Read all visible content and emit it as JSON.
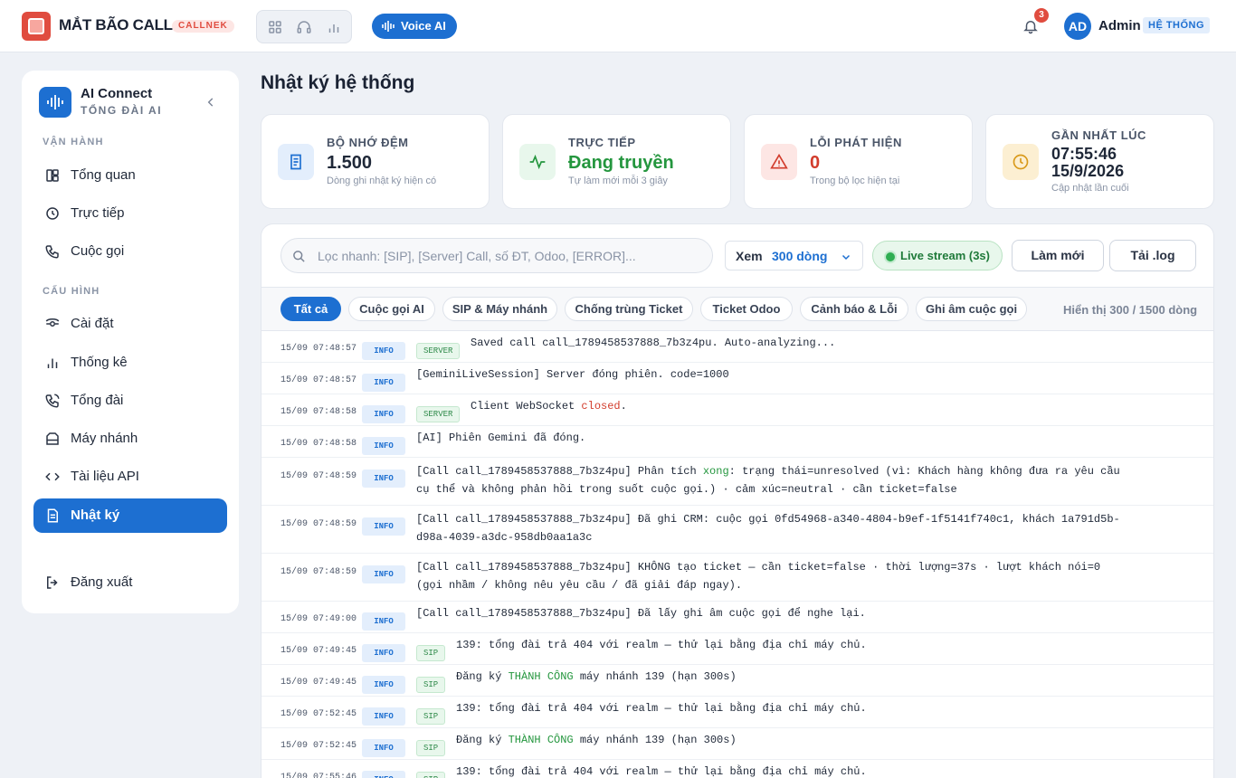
{
  "header": {
    "brand": "MẮT BÃO CALL",
    "brand_tag": "CALLNEK",
    "voice_ai": "Voice AI",
    "notif_count": "3",
    "avatar": "AD",
    "user": "Admin",
    "role": "HỆ THỐNG"
  },
  "sidebar": {
    "title": "AI Connect",
    "subtitle": "TỔNG ĐÀI AI",
    "section1": "VẬN HÀNH",
    "section2": "CẤU HÌNH",
    "items": [
      {
        "label": "Tổng quan"
      },
      {
        "label": "Trực tiếp"
      },
      {
        "label": "Cuộc gọi"
      },
      {
        "label": "Cài đặt"
      },
      {
        "label": "Thống kê"
      },
      {
        "label": "Tổng đài"
      },
      {
        "label": "Máy nhánh"
      },
      {
        "label": "Tài liệu API"
      },
      {
        "label": "Nhật ký"
      }
    ],
    "logout": "Đăng xuất"
  },
  "page": {
    "title": "Nhật ký hệ thống"
  },
  "cards": [
    {
      "label": "BỘ NHỚ ĐỆM",
      "value": "1.500",
      "sub": "Dòng ghi nhật ký hiện có",
      "color": "#1d6fd1",
      "icon": "document-icon"
    },
    {
      "label": "TRỰC TIẾP",
      "value": "Đang truyền",
      "sub": "Tự làm mới mỗi 3 giây",
      "color": "#24963e",
      "icon": "pulse-icon"
    },
    {
      "label": "LỖI PHÁT HIỆN",
      "value": "0",
      "sub": "Trong bộ lọc hiện tại",
      "color": "#d23c2c",
      "icon": "warning-icon"
    },
    {
      "label": "GẦN NHẤT LÚC",
      "value": "07:55:46",
      "value2": "15/9/2026",
      "sub": "Cập nhật lần cuối",
      "color": "#d99a1b",
      "icon": "clock-icon"
    }
  ],
  "toolbar": {
    "search_placeholder": "Lọc nhanh: [SIP], [Server] Call, số ĐT, Odoo, [ERROR]...",
    "view_label": "Xem",
    "view_value": "300 dòng",
    "live": "Live stream (3s)",
    "refresh": "Làm mới",
    "download": "Tải .log"
  },
  "filters": {
    "chips": [
      "Tất cả",
      "Cuộc gọi AI",
      "SIP & Máy nhánh",
      "Chống trùng Ticket",
      "Ticket Odoo",
      "Cảnh báo & Lỗi",
      "Ghi âm cuộc gọi"
    ],
    "count": "Hiển thị 300 / 1500 dòng"
  },
  "logs": [
    {
      "ts": "15/09 07:48:57",
      "level": "INFO",
      "tag": "SERVER",
      "parts": [
        {
          "t": "Saved call call_1789458537888_7b3z4pu. Auto-analyzing..."
        }
      ]
    },
    {
      "ts": "15/09 07:48:57",
      "level": "INFO",
      "tag": "",
      "parts": [
        {
          "t": "[GeminiLiveSession] Server đóng phiên. code=1000"
        }
      ]
    },
    {
      "ts": "15/09 07:48:58",
      "level": "INFO",
      "tag": "SERVER",
      "parts": [
        {
          "t": "Client WebSocket "
        },
        {
          "t": "closed",
          "c": "red"
        },
        {
          "t": "."
        }
      ]
    },
    {
      "ts": "15/09 07:48:58",
      "level": "INFO",
      "tag": "",
      "parts": [
        {
          "t": "[AI] Phiên Gemini đã đóng."
        }
      ]
    },
    {
      "ts": "15/09 07:48:59",
      "level": "INFO",
      "tag": "",
      "parts": [
        {
          "t": "[Call call_1789458537888_7b3z4pu] Phân tích "
        },
        {
          "t": "xong",
          "c": "green"
        },
        {
          "t": ": trạng thái=unresolved (vì: Khách hàng không đưa ra yêu cầu cụ thể và không phản hồi trong suốt cuộc gọi.) · cảm xúc=neutral · cần ticket=false"
        }
      ]
    },
    {
      "ts": "15/09 07:48:59",
      "level": "INFO",
      "tag": "",
      "parts": [
        {
          "t": "[Call call_1789458537888_7b3z4pu] Đã ghi CRM: cuộc gọi 0fd54968-a340-4804-b9ef-1f5141f740c1, khách 1a791d5b-d98a-4039-a3dc-958db0aa1a3c"
        }
      ]
    },
    {
      "ts": "15/09 07:48:59",
      "level": "INFO",
      "tag": "",
      "parts": [
        {
          "t": "[Call call_1789458537888_7b3z4pu] KHÔNG tạo ticket — cần ticket=false · thời lượng=37s · lượt khách nói=0 (gọi nhầm / không nêu yêu cầu / đã giải đáp ngay)."
        }
      ]
    },
    {
      "ts": "15/09 07:49:00",
      "level": "INFO",
      "tag": "",
      "parts": [
        {
          "t": "[Call call_1789458537888_7b3z4pu] Đã lấy ghi âm cuộc gọi để nghe lại."
        }
      ]
    },
    {
      "ts": "15/09 07:49:45",
      "level": "INFO",
      "tag": "SIP",
      "parts": [
        {
          "t": "139: tổng đài trả 404 với realm — thử lại bằng địa chỉ máy chủ."
        }
      ]
    },
    {
      "ts": "15/09 07:49:45",
      "level": "INFO",
      "tag": "SIP",
      "parts": [
        {
          "t": "Đăng ký "
        },
        {
          "t": "THÀNH CÔNG",
          "c": "green"
        },
        {
          "t": " máy nhánh 139 (hạn 300s)"
        }
      ]
    },
    {
      "ts": "15/09 07:52:45",
      "level": "INFO",
      "tag": "SIP",
      "parts": [
        {
          "t": "139: tổng đài trả 404 với realm — thử lại bằng địa chỉ máy chủ."
        }
      ]
    },
    {
      "ts": "15/09 07:52:45",
      "level": "INFO",
      "tag": "SIP",
      "parts": [
        {
          "t": "Đăng ký "
        },
        {
          "t": "THÀNH CÔNG",
          "c": "green"
        },
        {
          "t": " máy nhánh 139 (hạn 300s)"
        }
      ]
    },
    {
      "ts": "15/09 07:55:46",
      "level": "INFO",
      "tag": "SIP",
      "parts": [
        {
          "t": "139: tổng đài trả 404 với realm — thử lại bằng địa chỉ máy chủ."
        }
      ]
    }
  ]
}
